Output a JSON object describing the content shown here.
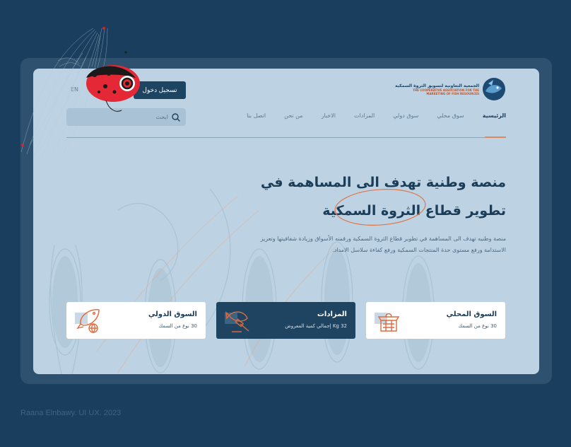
{
  "logo": {
    "name_ar": "الجمعية التعاونية لتسويق الثروة السمكية",
    "name_en_line1": "THE COOPERATIVE ASSOCIATION FOR THE",
    "name_en_line2": "MARKETING OF FISH RESOURCES"
  },
  "header": {
    "login_label": "تسجيل دخول",
    "lang_label": "EN",
    "search_placeholder": "ابحث"
  },
  "nav": {
    "items": [
      "الرئيسية",
      "سوق محلي",
      "سوق دولي",
      "المزادات",
      "الاخبار",
      "من نحن",
      "اتصل بنا"
    ]
  },
  "hero": {
    "title_line1": "منصة وطنية تهدف الى المساهمة في",
    "title_line2": "تطوير قطاع الثروة السمكية",
    "description": "منصة وطنيه تهدف الى المساهمة في تطوير قطاع الثروة السمكية ورقمنه الأسواق وزيادة شفافيتها وتعزيز الاستدامة ورفع مستوى حدة المنتجات السمكية ورفع كفاءة سلاسل الامداد."
  },
  "cards": [
    {
      "title": "السوق المحلي",
      "sub": "30 نوع من السمك",
      "icon": "market-stall-icon"
    },
    {
      "title": "المزادات",
      "sub": "Kg 32 إجمالي كمية المعروض",
      "icon": "auction-fish-icon"
    },
    {
      "title": "السوق الدولي",
      "sub": "30 نوع من السمك",
      "icon": "international-fish-icon"
    }
  ],
  "colors": {
    "background": "#1a3f5e",
    "page": "#bdd3e3",
    "primary": "#1e4461",
    "accent": "#e06a3c"
  },
  "credit": "Raana Elnbawy. UI UX. 2023"
}
